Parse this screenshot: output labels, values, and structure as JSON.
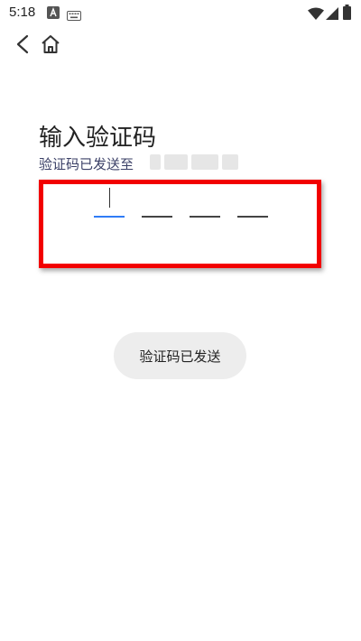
{
  "status_bar": {
    "time": "5:18",
    "left_icons": [
      "app-notification-icon",
      "keyboard-icon"
    ],
    "right_icons": [
      "wifi-icon",
      "signal-icon",
      "battery-icon"
    ]
  },
  "nav": {
    "back_icon": "chevron-left-icon",
    "home_icon": "home-icon"
  },
  "page": {
    "title": "输入验证码",
    "subtitle": "验证码已发送至",
    "phone_number_masked": true
  },
  "otp": {
    "digit_count": 4,
    "active_index": 0,
    "values": [
      "",
      "",
      "",
      ""
    ]
  },
  "toast": {
    "message": "验证码已发送"
  },
  "colors": {
    "highlight": "#f20000",
    "active_slot": "#2f7cf6",
    "toast_bg": "#ededed"
  }
}
